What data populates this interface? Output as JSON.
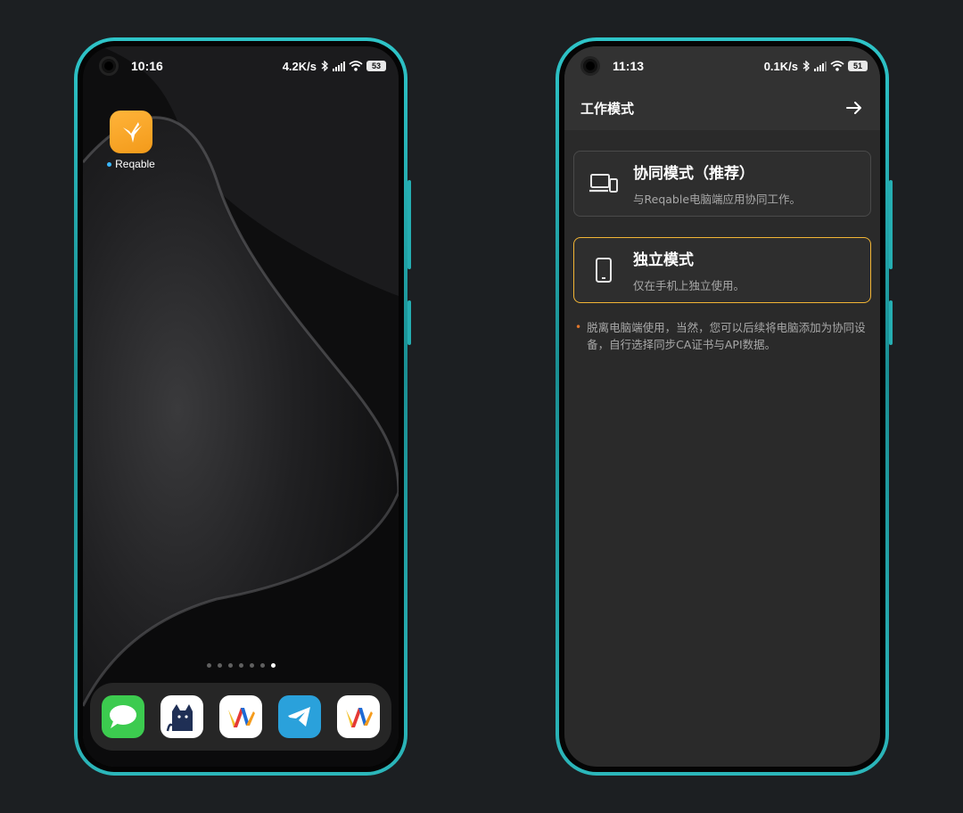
{
  "left_phone": {
    "status": {
      "time": "10:16",
      "net_speed": "4.2K/s",
      "battery": "53"
    },
    "app": {
      "label": "Reqable",
      "icon": "hummingbird-icon"
    },
    "page_dots": {
      "count": 7,
      "active": 7
    },
    "dock": [
      {
        "icon": "messages-icon",
        "color": "#3ccb4f"
      },
      {
        "icon": "cat-app-icon",
        "color": "#ffffff"
      },
      {
        "icon": "v-logo-icon",
        "color": "#ffffff"
      },
      {
        "icon": "telegram-icon",
        "color": "#2aa1db"
      },
      {
        "icon": "v-logo-icon",
        "color": "#ffffff"
      }
    ]
  },
  "right_phone": {
    "status": {
      "time": "11:13",
      "net_speed": "0.1K/s",
      "battery": "51"
    },
    "appbar": {
      "title": "工作模式",
      "action_icon": "arrow-right-icon"
    },
    "modes": [
      {
        "icon": "devices-icon",
        "title": "协同模式（推荐）",
        "desc": "与Reqable电脑端应用协同工作。",
        "selected": false
      },
      {
        "icon": "phone-icon",
        "title": "独立模式",
        "desc": "仅在手机上独立使用。",
        "selected": true
      }
    ],
    "note_bullet": "•",
    "note": "脱离电脑端使用，当然，您可以后续将电脑添加为协同设备，自行选择同步CA证书与API数据。"
  },
  "colors": {
    "accent_selected": "#f2b535",
    "frame": "#2ec4c8",
    "app_icon_bg": "#f7a82a"
  }
}
